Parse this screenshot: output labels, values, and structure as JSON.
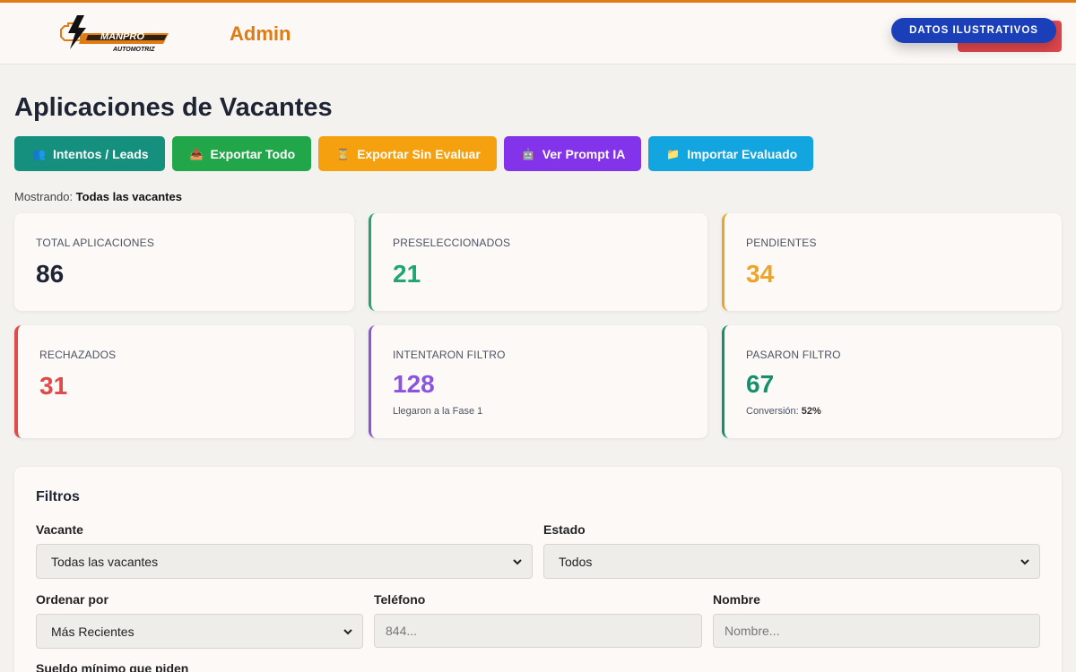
{
  "header": {
    "admin_label": "Admin",
    "badge_label": "DATOS ILUSTRATIVOS",
    "logo": {
      "brand": "MANPRO",
      "tagline": "AUTOMOTRIZ",
      "icon": "engine-bolt-icon"
    }
  },
  "page": {
    "title": "Aplicaciones de Vacantes",
    "showing_prefix": "Mostrando:",
    "showing_value": "Todas las vacantes"
  },
  "actions": [
    {
      "label": "Intentos / Leads",
      "icon": "users-icon",
      "glyph": "👥",
      "color": "#15907e"
    },
    {
      "label": "Exportar Todo",
      "icon": "inbox-icon",
      "glyph": "📤",
      "color": "#22a64a"
    },
    {
      "label": "Exportar Sin Evaluar",
      "icon": "hourglass-icon",
      "glyph": "⏳",
      "color": "#f5a00f"
    },
    {
      "label": "Ver Prompt IA",
      "icon": "robot-icon",
      "glyph": "🤖",
      "color": "#8334ea"
    },
    {
      "label": "Importar Evaluado",
      "icon": "folder-icon",
      "glyph": "📁",
      "color": "#12a5e0"
    }
  ],
  "stats": {
    "total": {
      "label": "TOTAL APLICACIONES",
      "value": "86",
      "color": "#1e2433"
    },
    "preseleccionados": {
      "label": "PRESELECCIONADOS",
      "value": "21",
      "color": "#1fa672"
    },
    "pendientes": {
      "label": "PENDIENTES",
      "value": "34",
      "color": "#eea428"
    },
    "rechazados": {
      "label": "RECHAZADOS",
      "value": "31",
      "color": "#df4a4a"
    },
    "intentaron": {
      "label": "INTENTARON FILTRO",
      "value": "128",
      "color": "#8a55dc",
      "sub": "Llegaron a la Fase 1"
    },
    "pasaron": {
      "label": "PASARON FILTRO",
      "value": "67",
      "color": "#15906a",
      "sub_prefix": "Conversión:",
      "sub_value": "52%"
    }
  },
  "filters": {
    "title": "Filtros",
    "vacante": {
      "label": "Vacante",
      "value": "Todas las vacantes"
    },
    "estado": {
      "label": "Estado",
      "value": "Todos"
    },
    "ordenar": {
      "label": "Ordenar por",
      "value": "Más Recientes"
    },
    "telefono": {
      "label": "Teléfono",
      "placeholder": "844..."
    },
    "nombre": {
      "label": "Nombre",
      "placeholder": "Nombre..."
    },
    "sueldo": {
      "label": "Sueldo mínimo que piden"
    }
  }
}
